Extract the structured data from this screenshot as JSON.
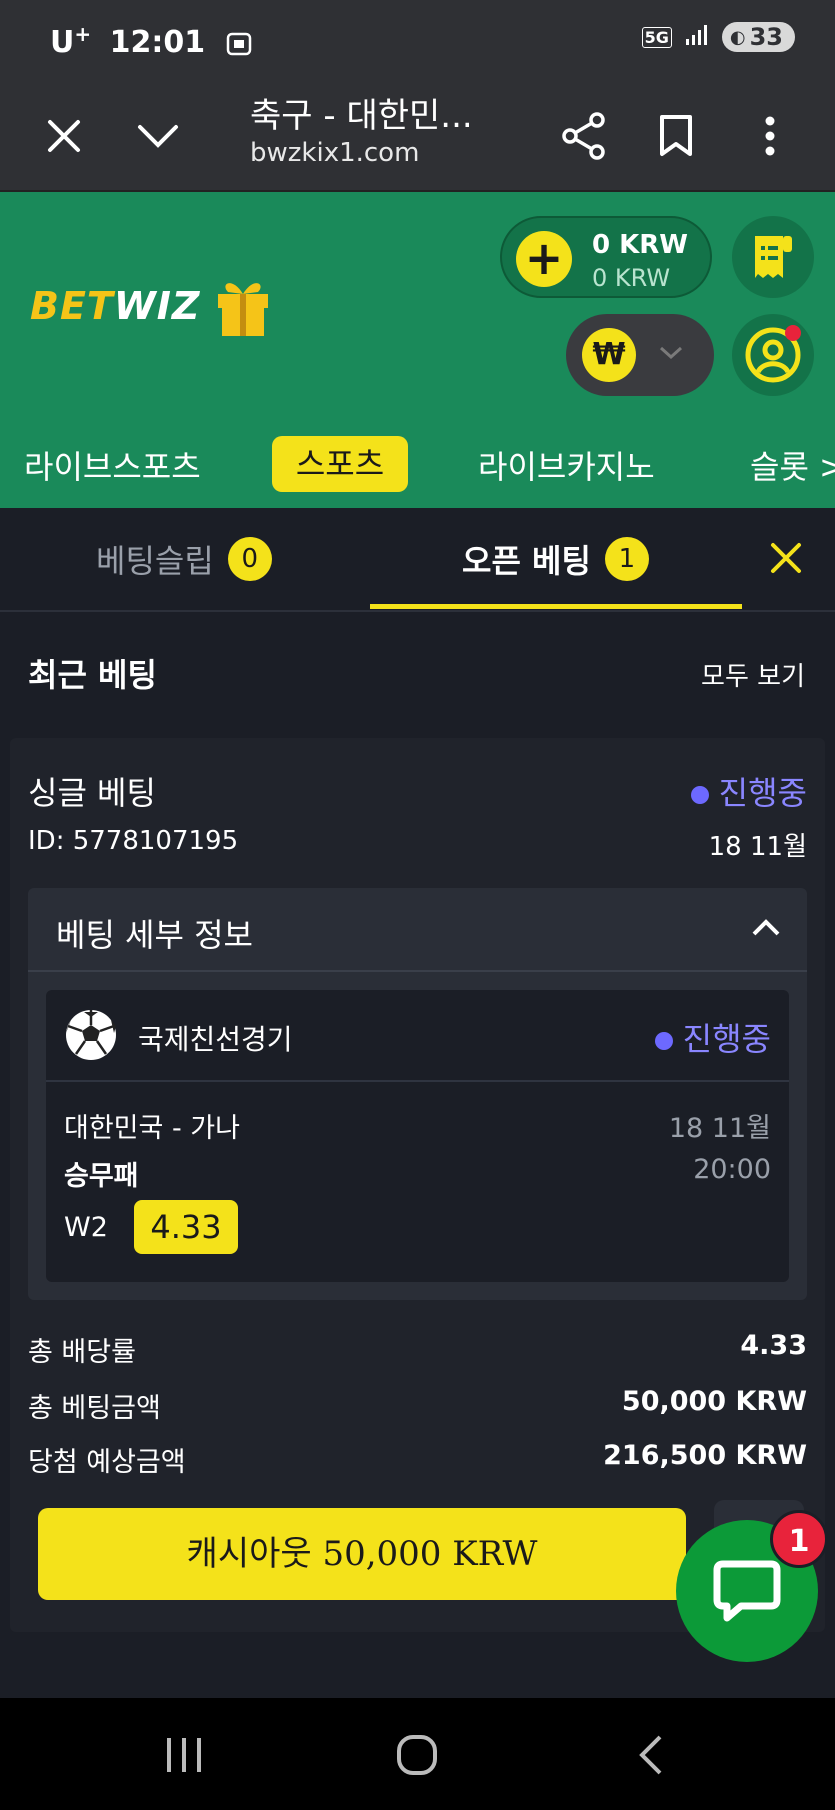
{
  "status_bar": {
    "carrier": "U",
    "carrier_sup": "+",
    "time": "12:01",
    "network": "5G",
    "battery": "33"
  },
  "browser": {
    "title": "축구 - 대한민...",
    "url": "bwzkix1.com"
  },
  "site": {
    "logo_part1": "BET",
    "logo_part2": "WIZ",
    "balance_main": "0 KRW",
    "balance_bonus": "0 KRW",
    "currency_symbol": "₩"
  },
  "nav": {
    "items": [
      "라이브스포츠",
      "스포츠",
      "라이브카지노",
      "슬롯 >"
    ],
    "active": "스포츠"
  },
  "tabs": {
    "betslip_label": "베팅슬립",
    "betslip_count": "0",
    "open_label": "오픈 베팅",
    "open_count": "1"
  },
  "recent": {
    "title": "최근 베팅",
    "view_all": "모두 보기"
  },
  "bet": {
    "type": "싱글 베팅",
    "status": "진행중",
    "id": "ID: 5778107195",
    "date": "18 11월",
    "details_title": "베팅 세부 정보",
    "match": {
      "league": "국제친선경기",
      "status": "진행중",
      "teams": "대한민국 - 가나",
      "date": "18 11월",
      "market": "승무패",
      "time": "20:00",
      "selection": "W2",
      "odds": "4.33"
    },
    "summary": [
      {
        "label": "총 배당률",
        "value": "4.33"
      },
      {
        "label": "총 베팅금액",
        "value": "50,000 KRW"
      },
      {
        "label": "당첨 예상금액",
        "value": "216,500 KRW"
      }
    ],
    "cashout": "캐시아웃 50,000 KRW"
  },
  "chat": {
    "badge": "1"
  },
  "colors": {
    "accent": "#f4e21a",
    "brand_green": "#1a8a5a",
    "status_purple": "#6d69ff",
    "bg": "#1b1e26"
  }
}
